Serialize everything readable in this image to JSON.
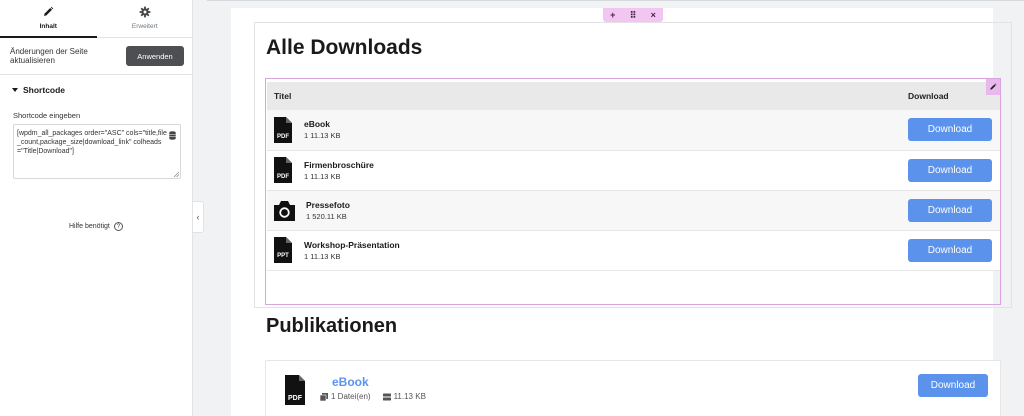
{
  "panel": {
    "tabs": [
      {
        "label": "Inhalt",
        "icon": "pencil-icon",
        "active": true
      },
      {
        "label": "Erweitert",
        "icon": "gear-icon",
        "active": false
      }
    ],
    "apply_text": "Änderungen der Seite aktualisieren",
    "apply_button": "Anwenden",
    "section_title": "Shortcode",
    "field_label": "Shortcode eingeben",
    "shortcode_value": "[wpdm_all_packages order=\"ASC\" cols=\"title,file_count,package_size|download_link\" colheads=\"Title|Download\"]",
    "help_text": "Hilfe benötigt"
  },
  "preview": {
    "handle": {
      "add": "+",
      "move": "⠿",
      "close": "×"
    },
    "downloads_heading": "Alle Downloads",
    "table": {
      "headers": [
        "Titel",
        "Download"
      ],
      "rows": [
        {
          "title": "eBook",
          "meta": "1  11.13 KB",
          "icon": "pdf-file-icon",
          "icon_text": "PDF",
          "button": "Download"
        },
        {
          "title": "Firmenbroschüre",
          "meta": "1  11.13 KB",
          "icon": "pdf-file-icon",
          "icon_text": "PDF",
          "button": "Download"
        },
        {
          "title": "Pressefoto",
          "meta": "1  520.11 KB",
          "icon": "camera-icon",
          "icon_text": "",
          "button": "Download"
        },
        {
          "title": "Workshop-Präsentation",
          "meta": "1  11.13 KB",
          "icon": "ppt-file-icon",
          "icon_text": "PPT",
          "button": "Download"
        }
      ]
    },
    "publications_heading": "Publikationen",
    "publication": {
      "title": "eBook",
      "files": "1 Datei(en)",
      "size": "11.13 KB",
      "icon_text": "PDF",
      "button": "Download"
    }
  },
  "colors": {
    "accent_blue": "#5b93ec",
    "selection_pink": "#d9a3e0",
    "dark_button": "#4d4f52"
  }
}
